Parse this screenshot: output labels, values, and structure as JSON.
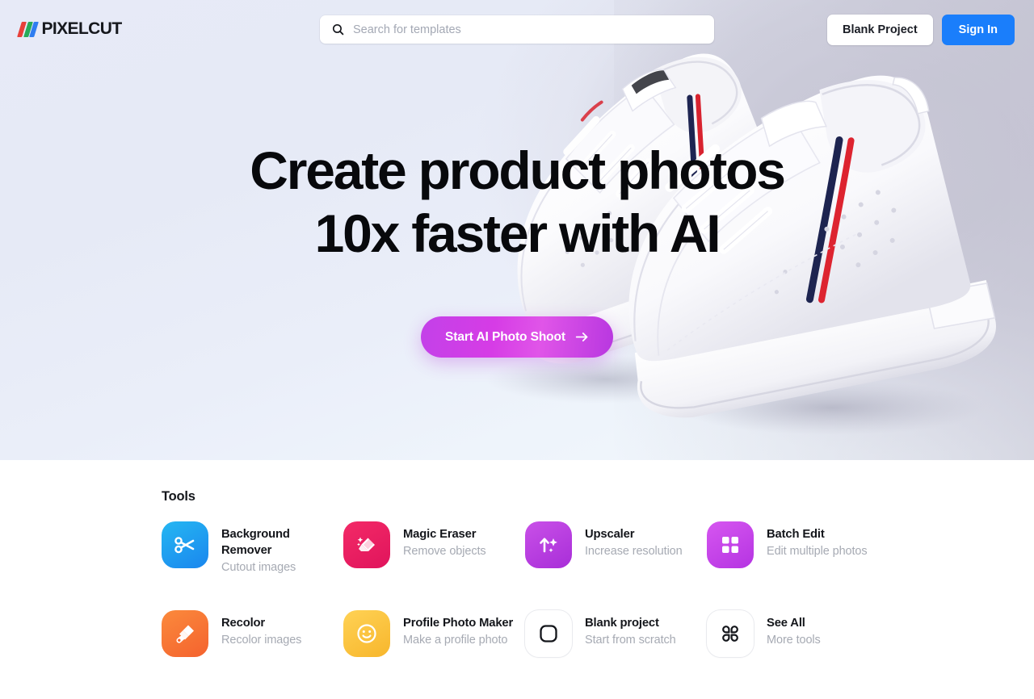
{
  "brand": {
    "name": "PIXELCUT",
    "slash_colors": [
      "#e8403a",
      "#27ab5a",
      "#2f7df0"
    ]
  },
  "header": {
    "search": {
      "icon": "search-icon",
      "placeholder": "Search for templates",
      "value": ""
    },
    "blank_project_label": "Blank Project",
    "sign_in_label": "Sign In",
    "sign_in_color": "#1a7efb"
  },
  "hero": {
    "headline_line1": "Create product photos",
    "headline_line2": "10x faster with AI",
    "cta_label": "Start AI Photo Shoot",
    "cta_arrow": "arrow-right-icon",
    "cta_gradient_from": "#c341e8",
    "cta_gradient_to": "#b837e0",
    "image_alt": "two white sneakers with navy and red stripes floating"
  },
  "tools": {
    "title": "Tools",
    "items": [
      {
        "name": "Background Remover",
        "desc": "Cutout images",
        "icon": "scissors-icon",
        "color_from": "#25b7f2",
        "color_to": "#1a86ee",
        "plain": false
      },
      {
        "name": "Magic Eraser",
        "desc": "Remove objects",
        "icon": "eraser-sparkle-icon",
        "color_from": "#f32a67",
        "color_to": "#e0145c",
        "plain": false
      },
      {
        "name": "Upscaler",
        "desc": "Increase resolution",
        "icon": "arrow-up-sparkle-icon",
        "color_from": "#c950e8",
        "color_to": "#a82ed8",
        "plain": false
      },
      {
        "name": "Batch Edit",
        "desc": "Edit multiple photos",
        "icon": "grid-four-icon",
        "color_from": "#d656f0",
        "color_to": "#b534e2",
        "plain": false
      },
      {
        "name": "Recolor",
        "desc": "Recolor images",
        "icon": "paint-brush-icon",
        "color_from": "#fb8a3c",
        "color_to": "#f4622e",
        "plain": false
      },
      {
        "name": "Profile Photo Maker",
        "desc": "Make a profile photo",
        "icon": "smiley-face-icon",
        "color_from": "#ffd255",
        "color_to": "#f7b62c",
        "plain": false
      },
      {
        "name": "Blank project",
        "desc": "Start from scratch",
        "icon": "rounded-square-icon",
        "color_from": "#ffffff",
        "color_to": "#ffffff",
        "plain": true
      },
      {
        "name": "See All",
        "desc": "More tools",
        "icon": "four-petal-grid-icon",
        "color_from": "#ffffff",
        "color_to": "#ffffff",
        "plain": true
      }
    ]
  }
}
